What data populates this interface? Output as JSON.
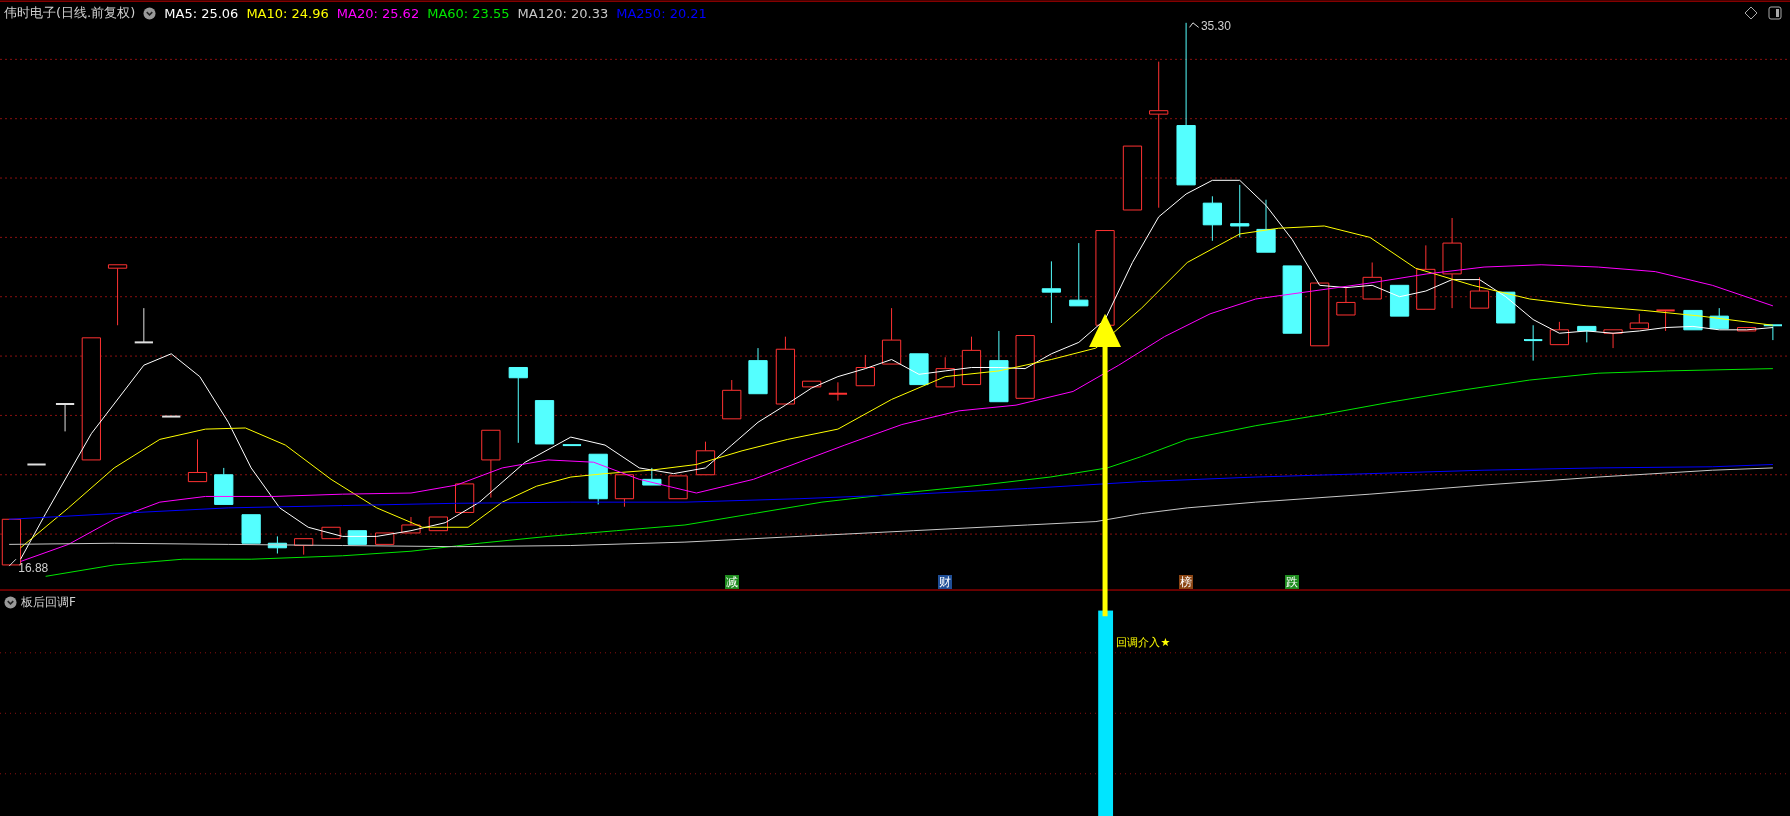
{
  "header": {
    "title": "伟时电子(日线.前复权)",
    "indicators": [
      {
        "label": "MA5: 25.06",
        "color": "#ffffff"
      },
      {
        "label": "MA10: 24.96",
        "color": "#ffff00"
      },
      {
        "label": "MA20: 25.62",
        "color": "#ff00ff"
      },
      {
        "label": "MA60: 23.55",
        "color": "#00e600"
      },
      {
        "label": "MA120: 20.33",
        "color": "#c8c8c8"
      },
      {
        "label": "MA250: 20.21",
        "color": "#0000ff"
      }
    ]
  },
  "price_chart": {
    "high_label": "35.30",
    "low_label": "16.88",
    "tags": [
      {
        "text": "减",
        "color": "#1e8c1e"
      },
      {
        "text": "财",
        "color": "#1f4e96"
      },
      {
        "text": "榜",
        "color": "#8b4513"
      },
      {
        "text": "跌",
        "color": "#1e8c1e"
      }
    ]
  },
  "indicator_panel": {
    "name": "板后回调F",
    "signal": "回调介入★"
  }
}
